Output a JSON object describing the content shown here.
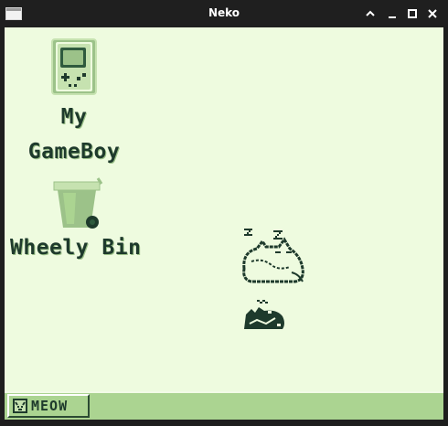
{
  "window": {
    "title": "Neko",
    "buttons": {
      "up": "⌃",
      "minimize": "_",
      "maximize": "□",
      "close": "✕"
    }
  },
  "desktop": {
    "icons": [
      {
        "name": "gameboy",
        "label_line1": "My",
        "label_line2": "GameBoy",
        "icon": "gameboy-icon"
      },
      {
        "name": "bin",
        "label": "Wheely Bin",
        "icon": "wheelie-bin-icon"
      }
    ],
    "sprites": [
      "sleeping-cat-sprite",
      "cat-sprite"
    ]
  },
  "taskbar": {
    "start_label": "MEOW",
    "start_icon": "cat-face-icon"
  },
  "colors": {
    "desktop_bg": "#eefbdf",
    "taskbar_bg": "#abd491",
    "dark": "#1e3a2c",
    "mid_green": "#9cc289"
  }
}
